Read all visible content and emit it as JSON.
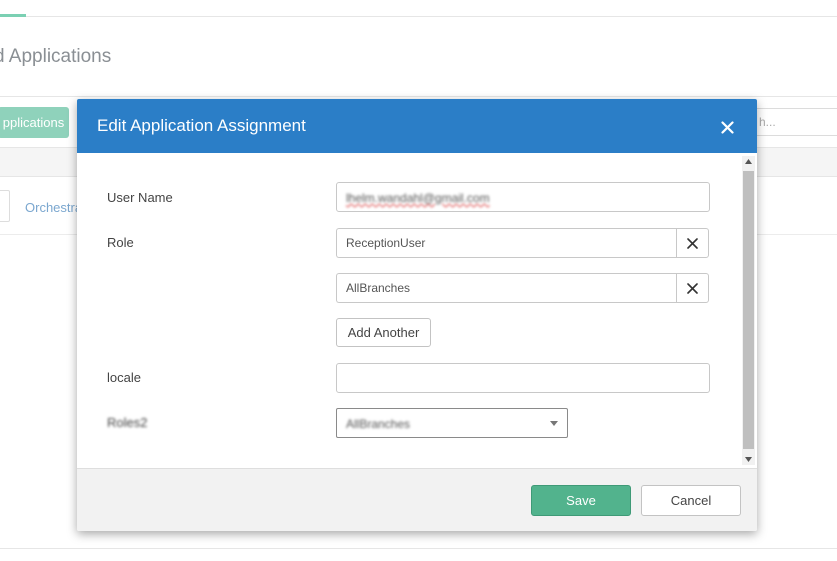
{
  "background": {
    "page_title": "d Applications",
    "applications_button": "pplications",
    "search_partial": "h...",
    "row_link": "Orchestra"
  },
  "modal": {
    "title": "Edit Application Assignment",
    "fields": {
      "user_name": {
        "label": "User Name",
        "value": "lhelm.wandahl@gmail.com"
      },
      "role": {
        "label": "Role",
        "values": [
          "ReceptionUser",
          "AllBranches"
        ]
      },
      "add_another": "Add Another",
      "locale": {
        "label": "locale",
        "value": ""
      },
      "roles2": {
        "label": "Roles2",
        "selected": "AllBranches"
      }
    },
    "footer": {
      "save": "Save",
      "cancel": "Cancel"
    }
  },
  "colors": {
    "header_blue": "#2b7ec7",
    "save_green": "#52b38d",
    "accent_teal": "#7bd0b3"
  },
  "icons": [
    "close-icon",
    "remove-icon",
    "chevron-down-icon",
    "scroll-up-icon",
    "scroll-down-icon"
  ]
}
